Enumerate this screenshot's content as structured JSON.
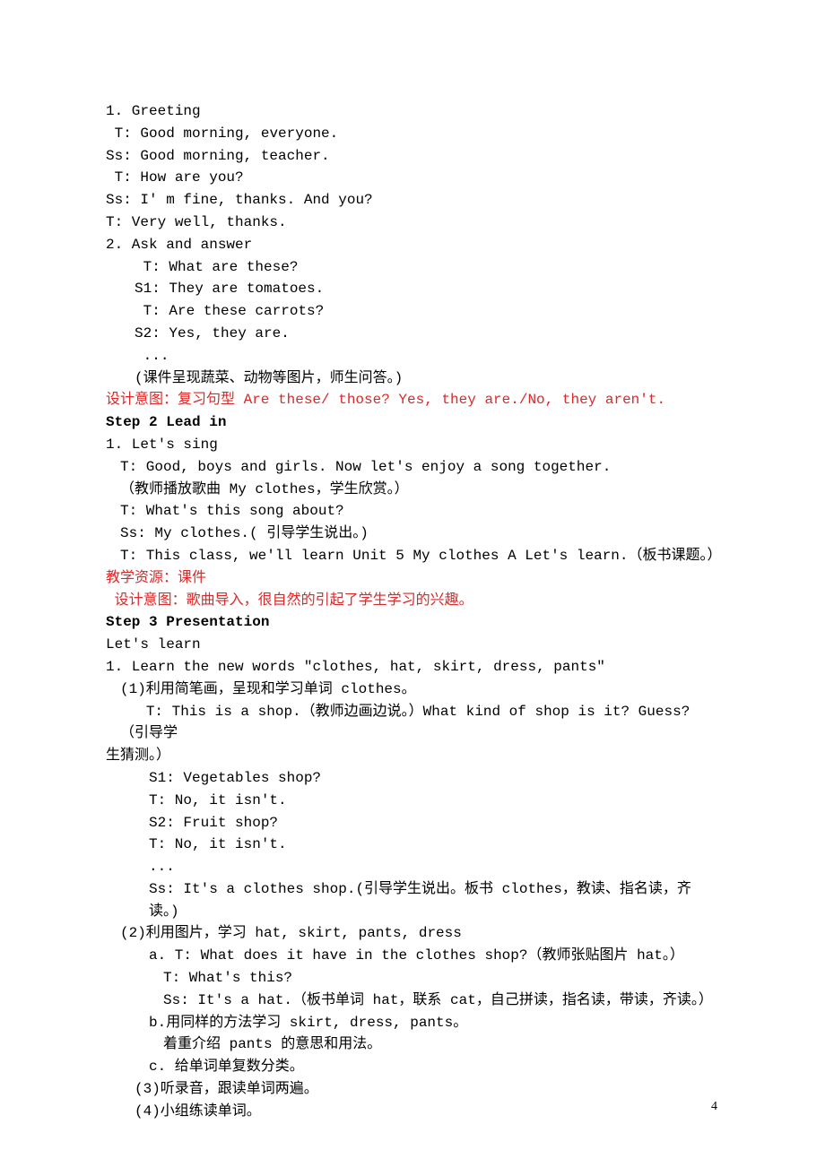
{
  "lines": [
    {
      "text": "1. Greeting",
      "cls": ""
    },
    {
      "text": " T: Good morning, everyone.",
      "cls": ""
    },
    {
      "text": "Ss: Good morning, teacher.",
      "cls": ""
    },
    {
      "text": " T: How are you?",
      "cls": ""
    },
    {
      "text": "Ss: I' m fine, thanks. And you?",
      "cls": ""
    },
    {
      "text": "T: Very well, thanks.",
      "cls": ""
    },
    {
      "text": "2. Ask and answer",
      "cls": ""
    },
    {
      "text": " T: What are these?",
      "cls": "indent2"
    },
    {
      "text": "S1: They are tomatoes.",
      "cls": "indent2"
    },
    {
      "text": " T: Are these carrots?",
      "cls": "indent2"
    },
    {
      "text": "S2: Yes, they are.",
      "cls": "indent2"
    },
    {
      "text": " ...",
      "cls": "indent2"
    },
    {
      "text": "(课件呈现蔬菜、动物等图片，师生问答。)",
      "cls": "indent2"
    },
    {
      "text": "设计意图：复习句型 Are these/ those? Yes, they are./No, they aren't.",
      "cls": "red"
    },
    {
      "text": "Step 2 Lead in",
      "cls": "bold"
    },
    {
      "text": "1. Let's sing",
      "cls": ""
    },
    {
      "text": "T: Good, boys and girls. Now let's enjoy a song together.",
      "cls": "indent1"
    },
    {
      "text": "（教师播放歌曲 My clothes，学生欣赏。）",
      "cls": "indent1"
    },
    {
      "text": "T: What's this song about?",
      "cls": "indent1"
    },
    {
      "text": "Ss: My clothes.( 引导学生说出。)",
      "cls": "indent1"
    },
    {
      "text": "T: This class, we'll learn Unit 5 My clothes A Let's learn.（板书课题。）",
      "cls": "indent1"
    },
    {
      "text": "教学资源：课件",
      "cls": "red"
    },
    {
      "text": " 设计意图：歌曲导入，很自然的引起了学生学习的兴趣。",
      "cls": "red"
    },
    {
      "text": "Step 3 Presentation",
      "cls": "bold"
    },
    {
      "text": "Let's learn",
      "cls": ""
    },
    {
      "text": "1. Learn the new words \"clothes, hat, skirt, dress, pants\"",
      "cls": ""
    },
    {
      "text": "(1)利用简笔画，呈现和学习单词 clothes。",
      "cls": "indent1"
    },
    {
      "text": "   T: This is a shop.（教师边画边说。）What kind of shop is it? Guess? （引导学",
      "cls": "indent1"
    },
    {
      "text": "生猜测。）",
      "cls": ""
    },
    {
      "text": "S1: Vegetables shop?",
      "cls": "indent3"
    },
    {
      "text": "T: No, it isn't.",
      "cls": "indent3"
    },
    {
      "text": "S2: Fruit shop?",
      "cls": "indent3"
    },
    {
      "text": "T: No, it isn't.",
      "cls": "indent3"
    },
    {
      "text": "...",
      "cls": "indent3"
    },
    {
      "text": "Ss: It's a clothes shop.(引导学生说出。板书 clothes，教读、指名读，齐读。)",
      "cls": "indent3"
    },
    {
      "text": "(2)利用图片，学习 hat, skirt, pants, dress",
      "cls": "indent1"
    },
    {
      "text": "a. T: What does it have in the clothes shop?（教师张贴图片 hat。）",
      "cls": "indent3"
    },
    {
      "text": "T: What's this?",
      "cls": "indent4"
    },
    {
      "text": "Ss: It's a hat.（板书单词 hat，联系 cat，自己拼读，指名读，带读，齐读。）",
      "cls": "indent4"
    },
    {
      "text": "b.用同样的方法学习 skirt, dress, pants。",
      "cls": "indent3"
    },
    {
      "text": "着重介绍 pants 的意思和用法。",
      "cls": "indent4"
    },
    {
      "text": "c. 给单词单复数分类。",
      "cls": "indent3"
    },
    {
      "text": "(3)听录音，跟读单词两遍。",
      "cls": "indent2"
    },
    {
      "text": "(4)小组练读单词。",
      "cls": "indent2"
    }
  ],
  "page_number": "4"
}
